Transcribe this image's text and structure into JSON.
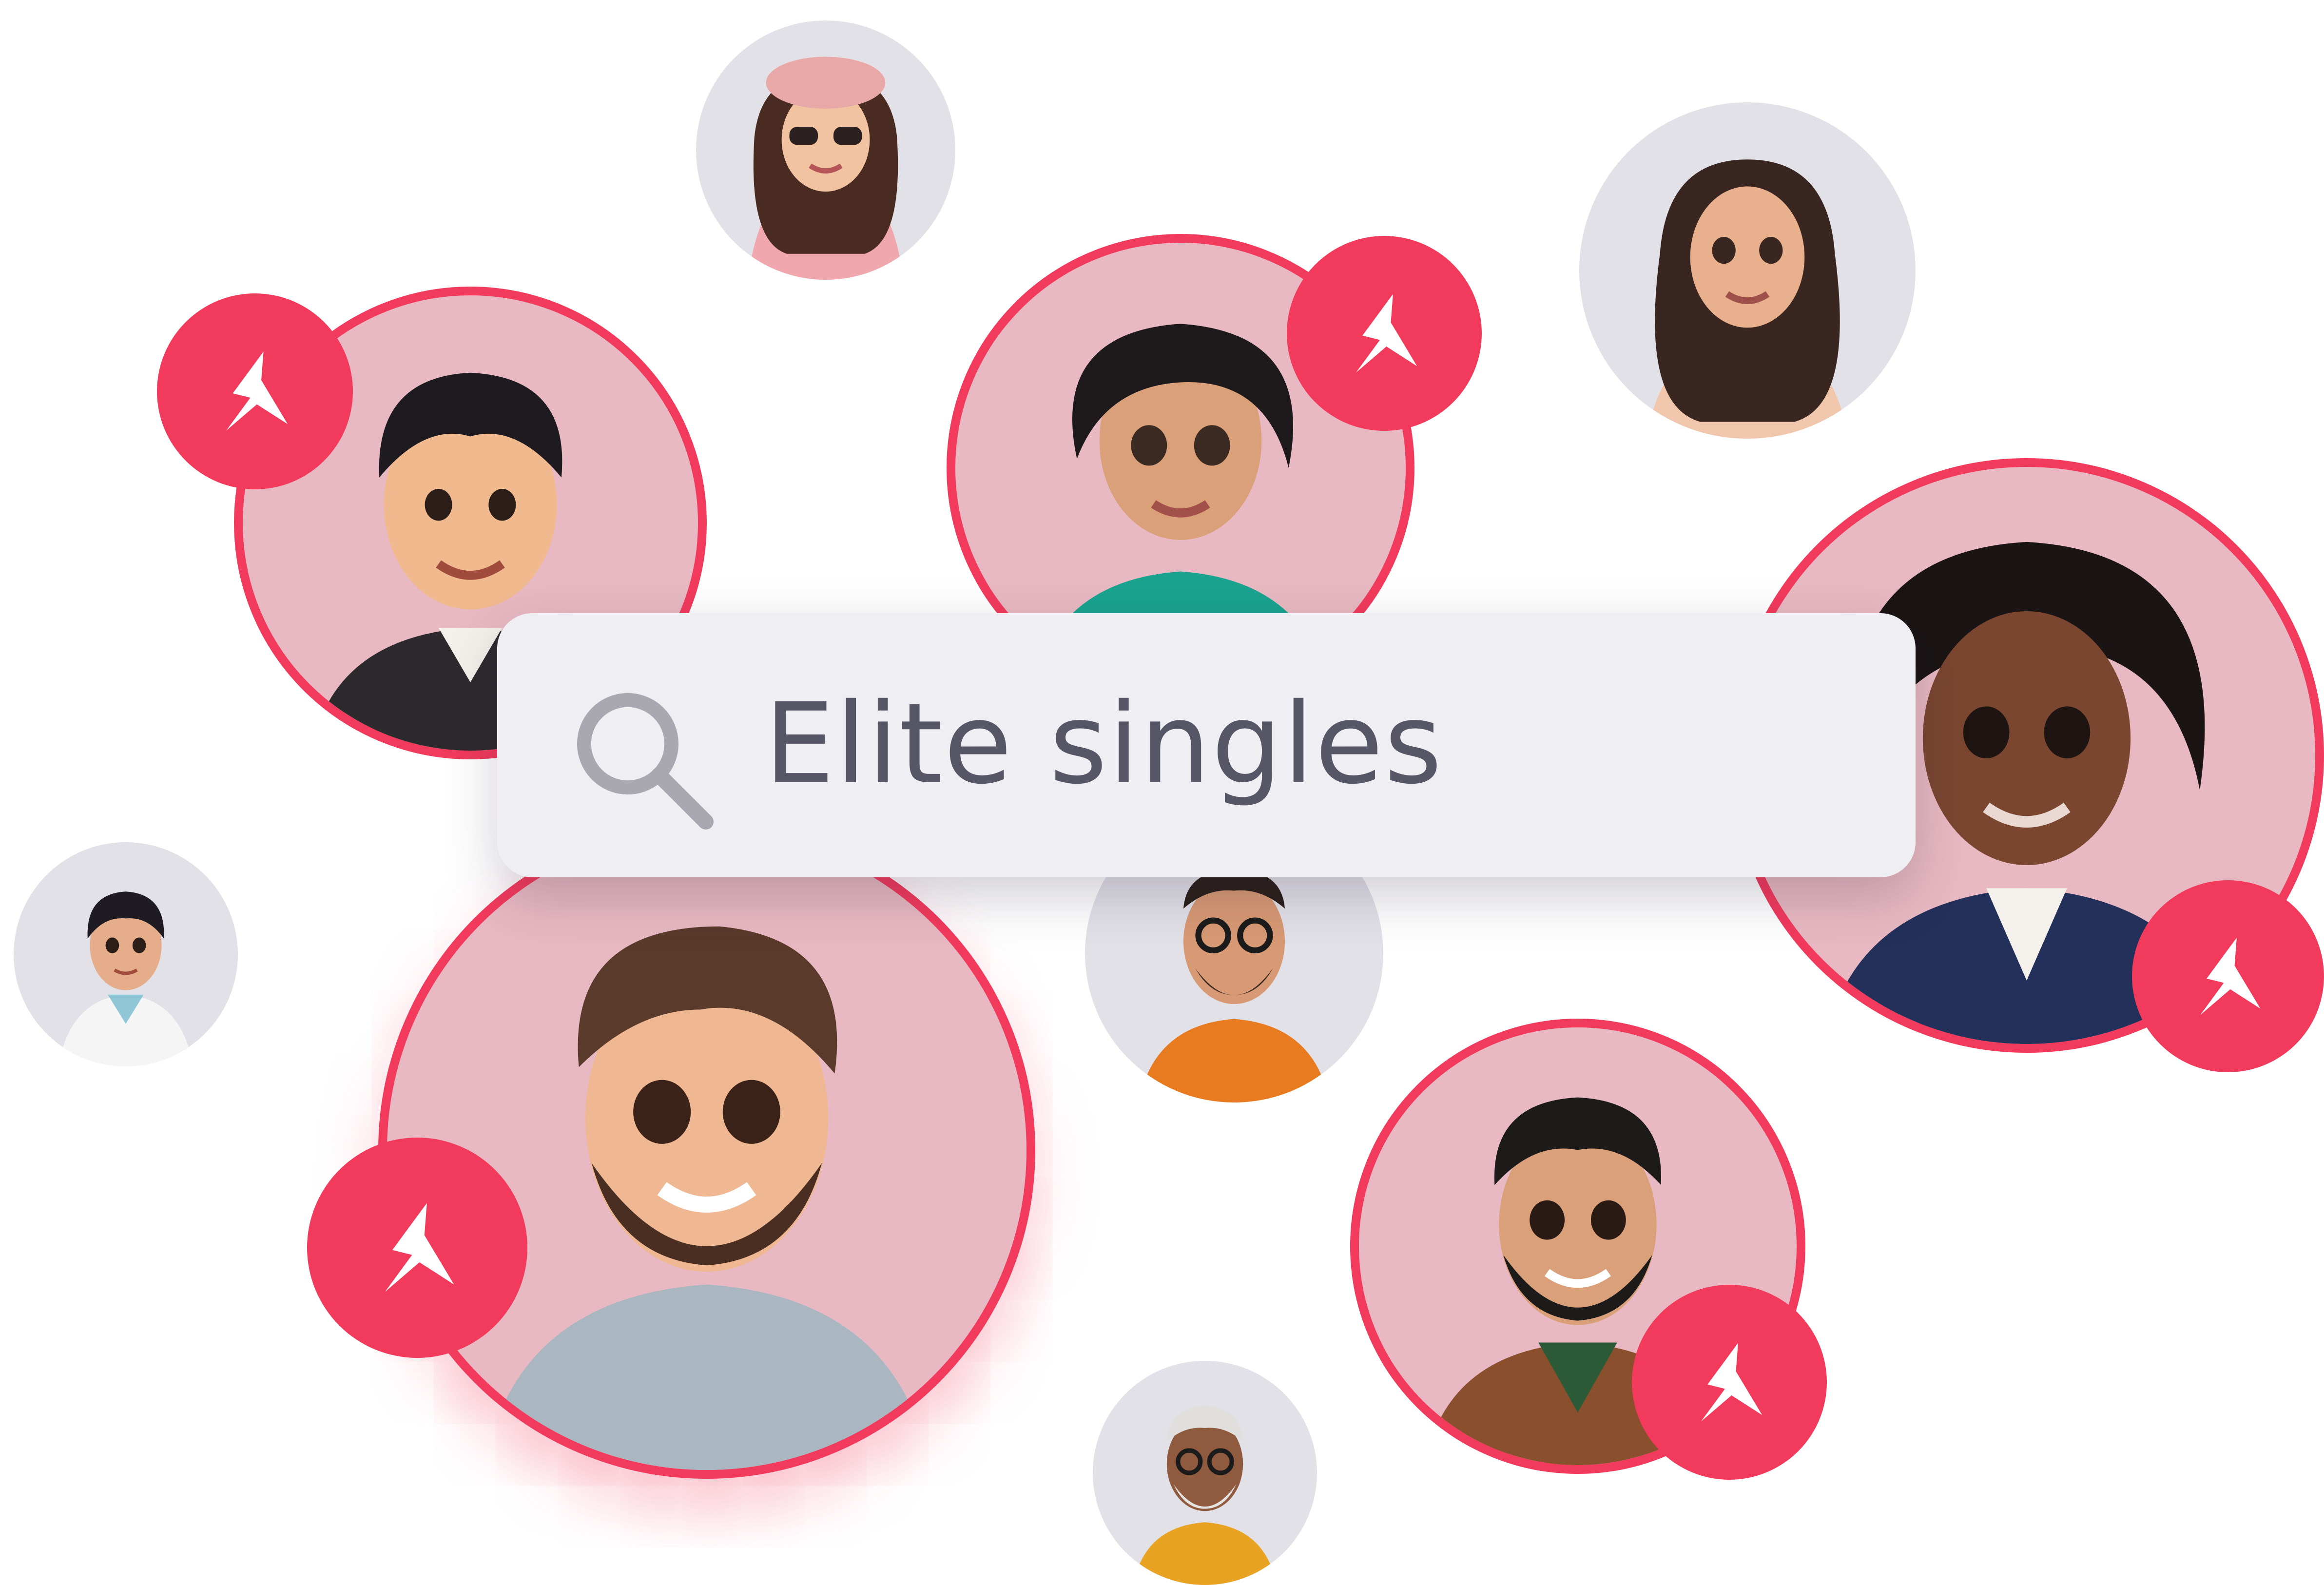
{
  "search": {
    "query": "Elite singles",
    "icon": "search-icon"
  },
  "avatars": [
    {
      "style": "gray",
      "badge": false,
      "description": "woman-pink-beret-sunglasses"
    },
    {
      "style": "gray",
      "badge": false,
      "description": "woman-long-hair-sweater"
    },
    {
      "style": "pink",
      "badge": true,
      "description": "man-black-hair-blazer"
    },
    {
      "style": "pink",
      "badge": true,
      "description": "woman-short-curly-hair-teal-top"
    },
    {
      "style": "pink",
      "badge": true,
      "description": "woman-curly-hair-navy-blazer"
    },
    {
      "style": "gray",
      "badge": false,
      "description": "woman-doctor-scrubs"
    },
    {
      "style": "gray",
      "badge": false,
      "description": "man-glasses-orange-hoodie"
    },
    {
      "style": "pink",
      "badge": true,
      "description": "man-beard-gray-hoodie"
    },
    {
      "style": "pink",
      "badge": true,
      "description": "man-beard-brown-jacket"
    },
    {
      "style": "gray",
      "badge": false,
      "description": "older-man-glasses-yellow-sweater"
    }
  ],
  "colors": {
    "accent": "#f23a5c",
    "avatar_pink_bg": "#e8b9c2",
    "avatar_gray_bg": "#e2e1e8",
    "search_bg": "#efeef2",
    "search_text": "#575666"
  },
  "badge_icon": "brand-logo-icon"
}
